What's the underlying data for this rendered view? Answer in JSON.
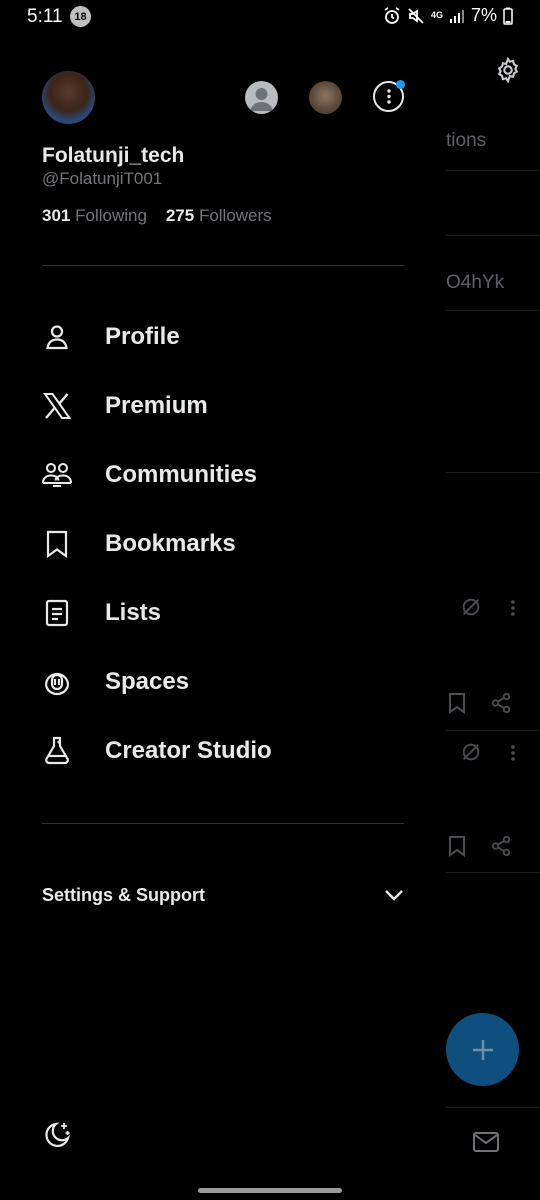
{
  "status_bar": {
    "time": "5:11",
    "notification_count": "18",
    "network": "4G",
    "battery": "7%"
  },
  "background": {
    "tab_fragment": "tions",
    "text_fragment": "O4hYk"
  },
  "drawer": {
    "user": {
      "name": "Folatunji_tech",
      "handle": "@FolatunjiT001"
    },
    "stats": {
      "following_count": "301",
      "following_label": "Following",
      "followers_count": "275",
      "followers_label": "Followers"
    },
    "menu": [
      {
        "label": "Profile",
        "icon": "person-icon"
      },
      {
        "label": "Premium",
        "icon": "x-logo-icon"
      },
      {
        "label": "Communities",
        "icon": "communities-icon"
      },
      {
        "label": "Bookmarks",
        "icon": "bookmark-icon"
      },
      {
        "label": "Lists",
        "icon": "list-icon"
      },
      {
        "label": "Spaces",
        "icon": "spaces-icon"
      },
      {
        "label": "Creator Studio",
        "icon": "flask-icon"
      }
    ],
    "settings_label": "Settings & Support"
  },
  "colors": {
    "background": "#000000",
    "text_primary": "#e7e9ea",
    "text_secondary": "#71767b",
    "divider": "#2f3336",
    "accent": "#1d9bf0"
  }
}
